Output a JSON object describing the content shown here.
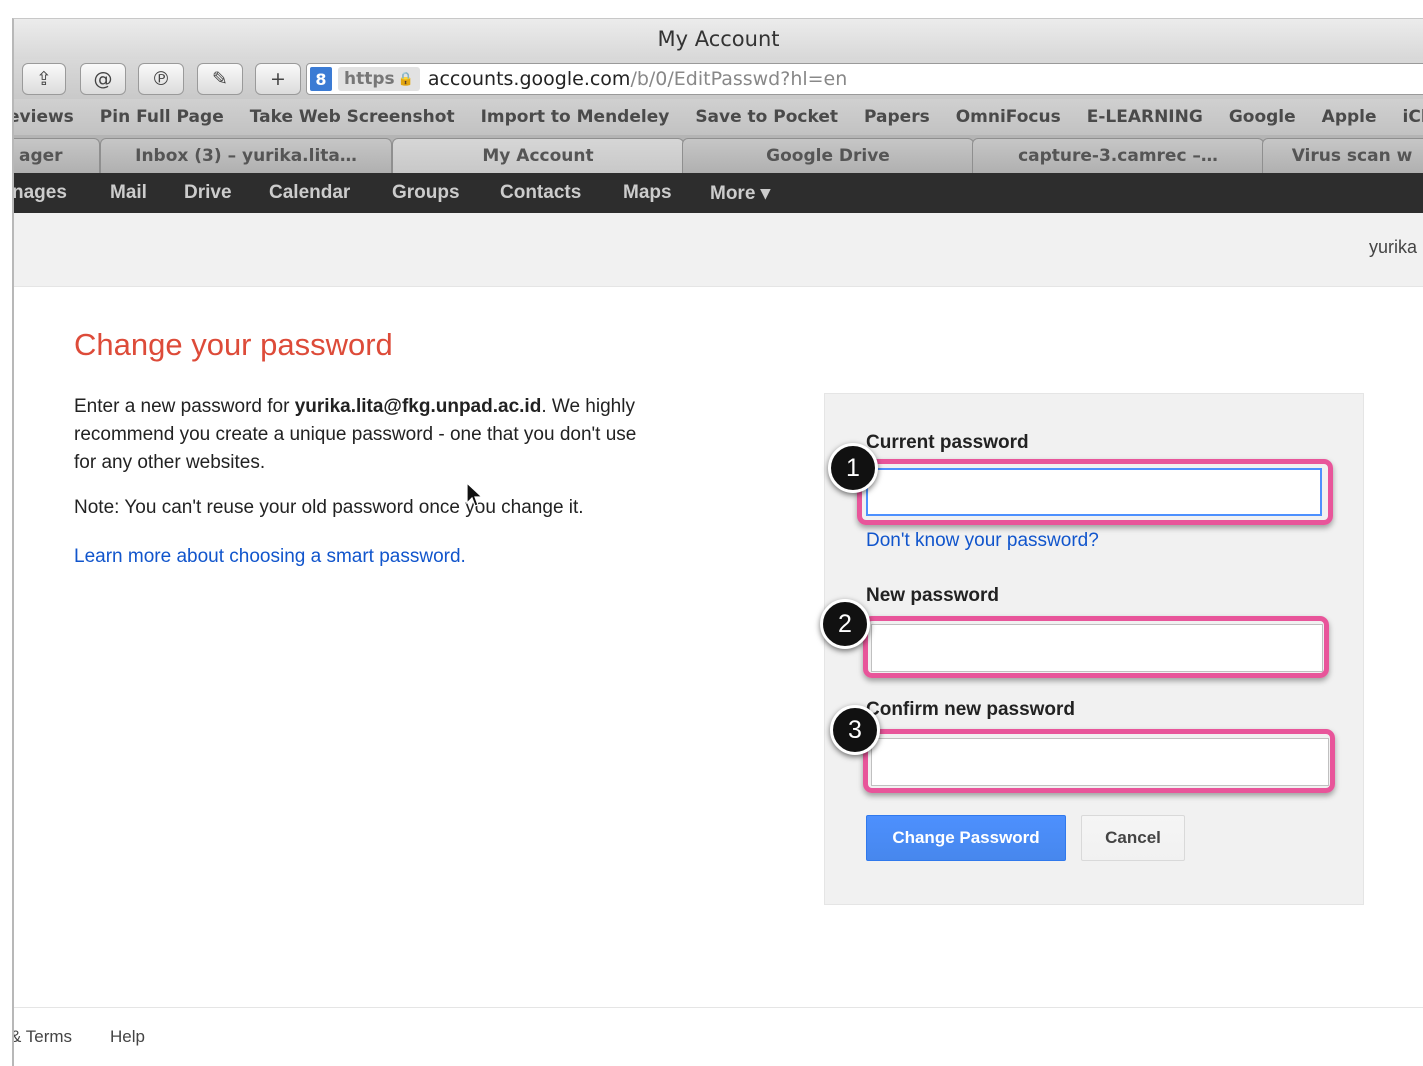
{
  "window": {
    "title": "My Account"
  },
  "toolbar": {
    "buttons": [
      {
        "icon": "share-icon",
        "glyph": "⇪"
      },
      {
        "icon": "spiral-icon",
        "glyph": "@"
      },
      {
        "icon": "pinterest-icon",
        "glyph": "℗"
      },
      {
        "icon": "evernote-icon",
        "glyph": "✎"
      },
      {
        "icon": "add-icon",
        "glyph": "+"
      }
    ],
    "url": {
      "search_badge": "8",
      "scheme": "https",
      "lock_glyph": "🔒",
      "host": "accounts.google.com",
      "path": "/b/0/EditPasswd?hl=en"
    }
  },
  "bookmarks": [
    "eviews",
    "Pin Full Page",
    "Take Web Screenshot",
    "Import to Mendeley",
    "Save to Pocket",
    "Papers",
    "OmniFocus",
    "E-LEARNING",
    "Google",
    "Apple",
    "iCloud"
  ],
  "tabs": [
    {
      "label": "ager"
    },
    {
      "label": "Inbox (3) – yurika.lita…"
    },
    {
      "label": "My Account"
    },
    {
      "label": "Google Drive"
    },
    {
      "label": "capture-3.camrec –…"
    },
    {
      "label": "Virus scan w"
    }
  ],
  "gbar": [
    "nages",
    "Mail",
    "Drive",
    "Calendar",
    "Groups",
    "Contacts",
    "Maps",
    "More ▾"
  ],
  "header": {
    "user": "yurika"
  },
  "content": {
    "title": "Change your password",
    "intro_prefix": "Enter a new password for ",
    "intro_email": "yurika.lita@fkg.unpad.ac.id",
    "intro_suffix": ". We highly recommend you create a unique password - one that you don't use for any other websites.",
    "note": "Note: You can't reuse your old password once you change it.",
    "learn_more": "Learn more about choosing a smart password."
  },
  "form": {
    "current_label": "Current password",
    "current_value": "",
    "dont_know": "Don't know your password?",
    "new_label": "New password",
    "new_value": "",
    "confirm_label": "Confirm new password",
    "confirm_value": "",
    "submit": "Change Password",
    "cancel": "Cancel"
  },
  "annotations": {
    "badge1": "1",
    "badge2": "2",
    "badge3": "3",
    "highlight_color": "#e8559a"
  },
  "footer": {
    "terms": "& Terms",
    "help": "Help"
  },
  "colors": {
    "title_red": "#dd4b39",
    "link_blue": "#1155cc",
    "button_blue": "#4d90fe"
  }
}
